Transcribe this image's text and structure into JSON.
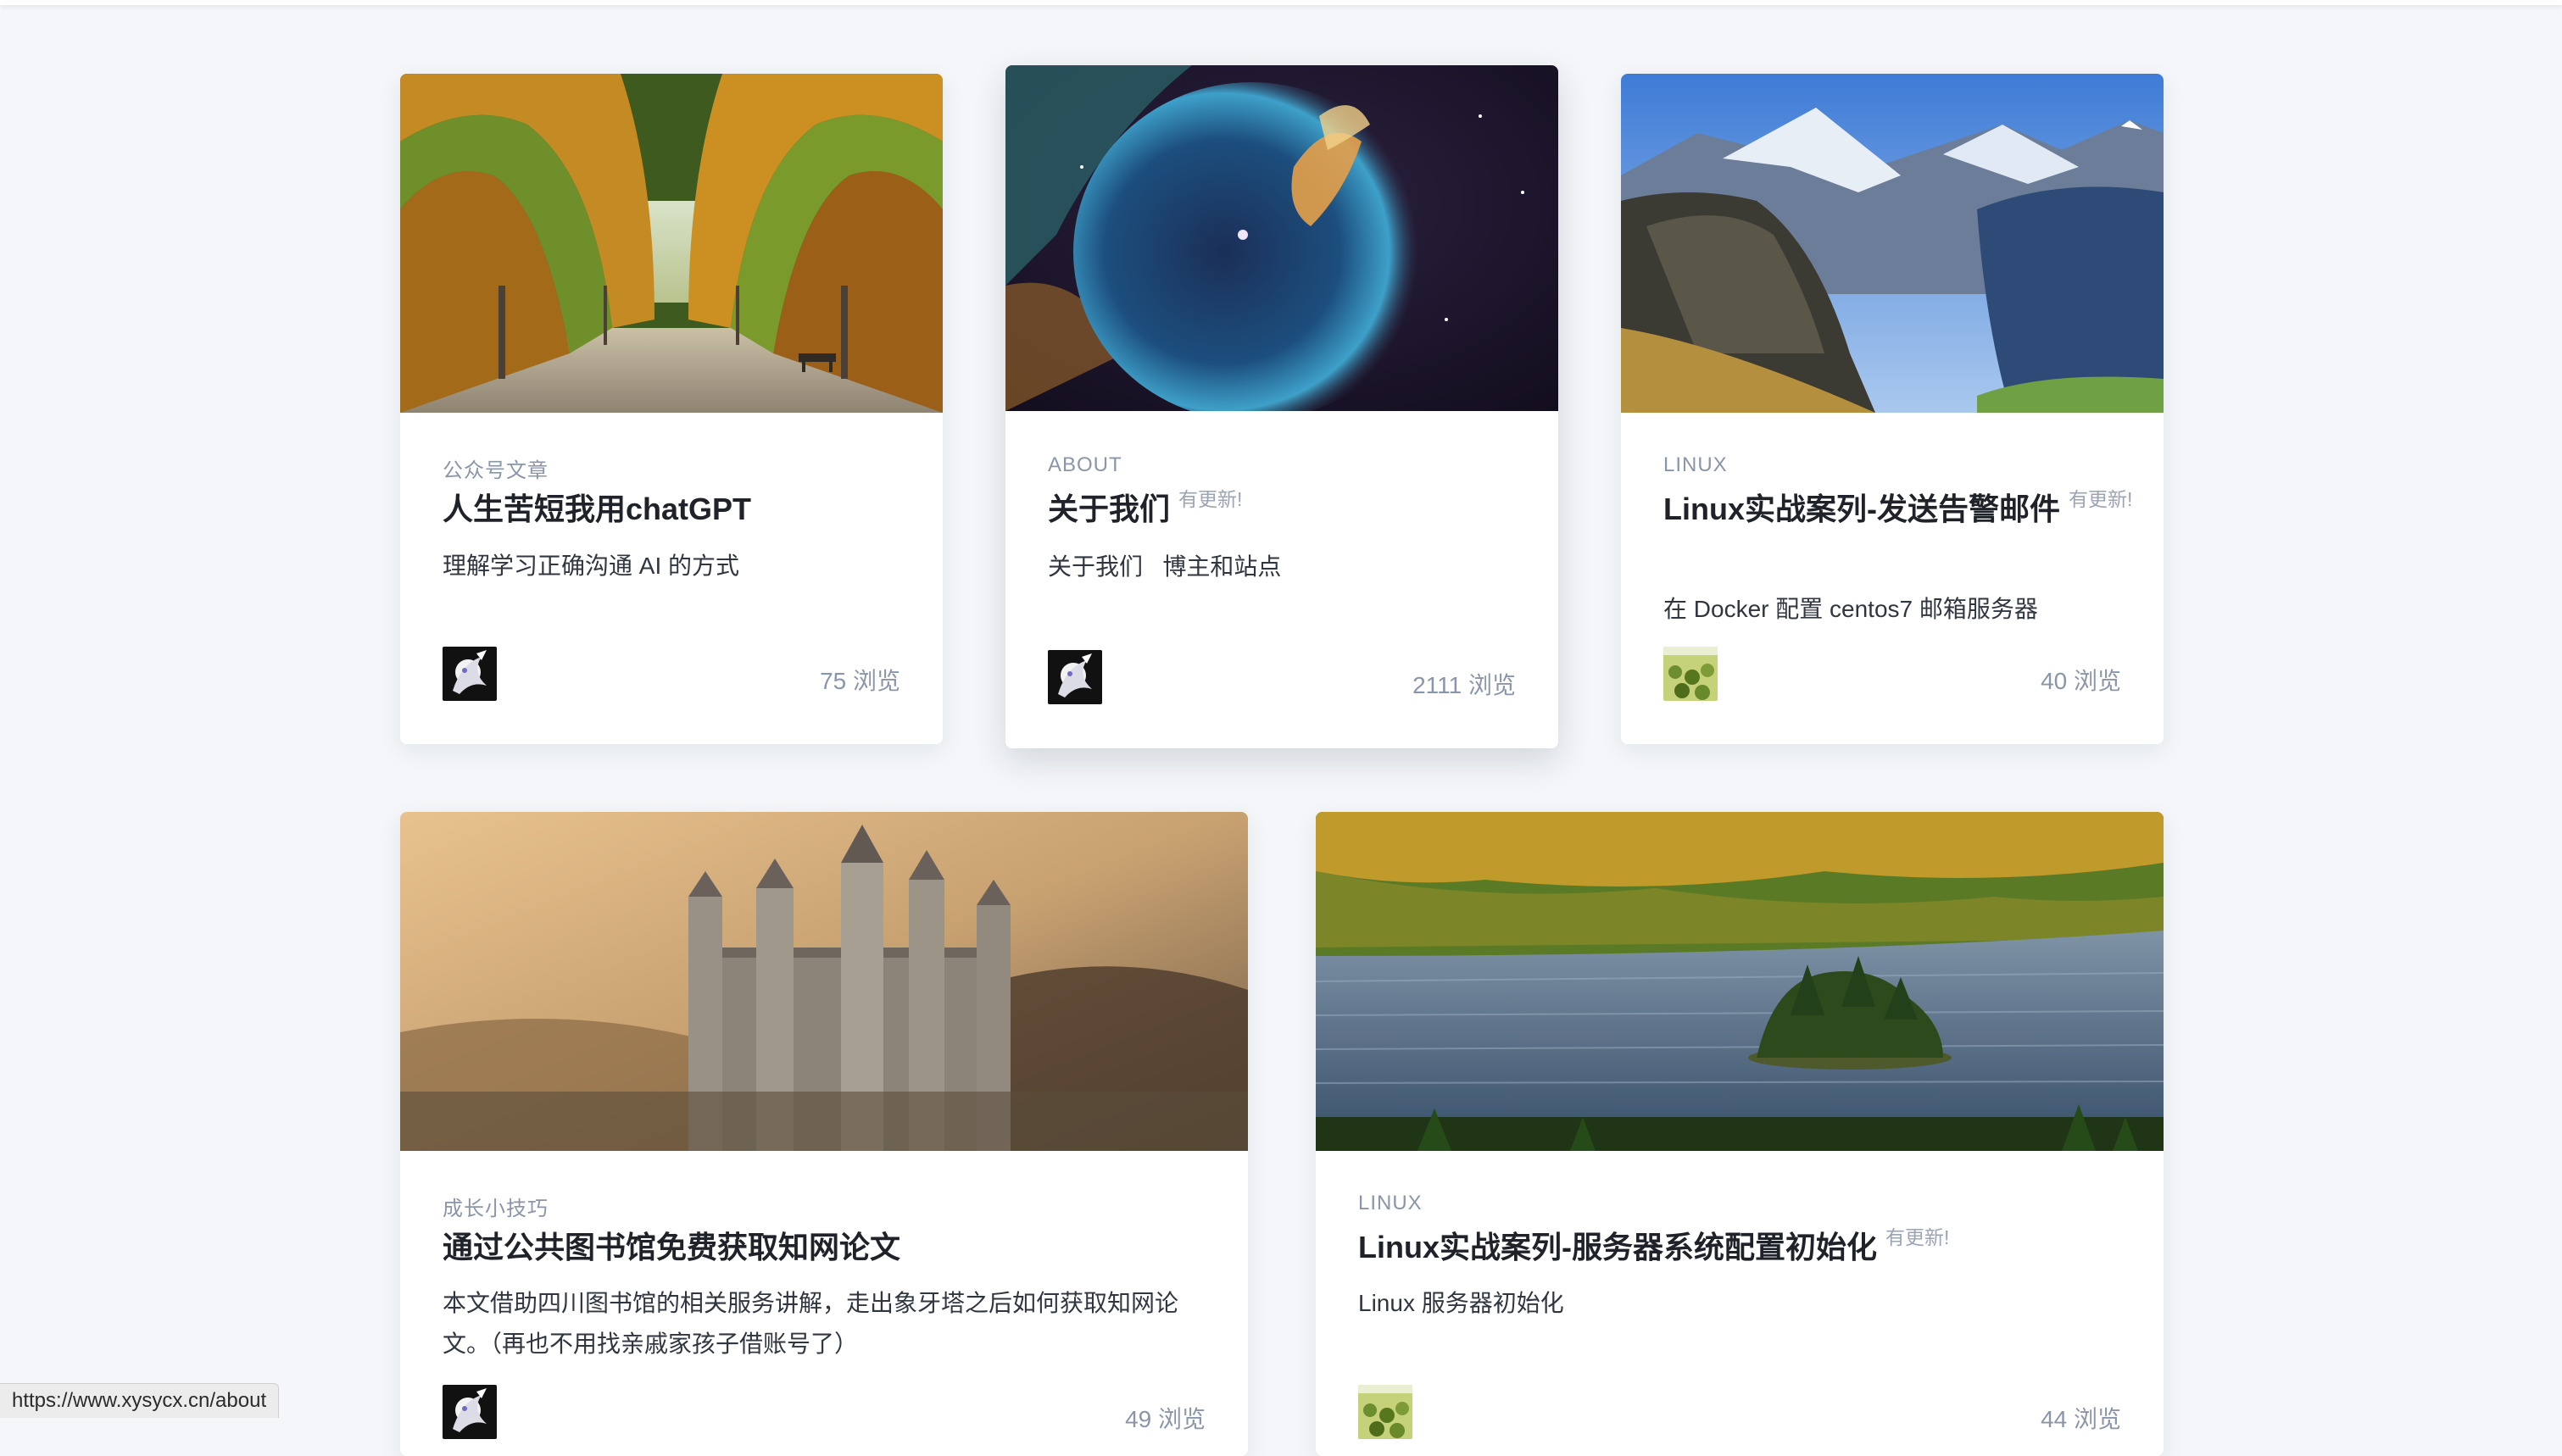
{
  "cards": [
    {
      "image": "autumn-tree-tunnel",
      "category": "公众号文章",
      "title": "人生苦短我用chatGPT",
      "updated": "",
      "excerpt": "理解学习正确沟通 AI 的方式",
      "avatar": "anime-avatar-icon",
      "views": "75 浏览"
    },
    {
      "image": "nebula-bubble",
      "category": "ABOUT",
      "title": "关于我们",
      "updated": "有更新!",
      "excerpt": "关于我们   博主和站点",
      "avatar": "anime-avatar-icon",
      "views": "2111 浏览"
    },
    {
      "image": "alpine-cliff",
      "category": "LINUX",
      "title": "Linux实战案列-发送告警邮件",
      "updated": "有更新!",
      "excerpt": "在 Docker 配置 centos7 邮箱服务器",
      "avatar": "field-avatar-icon",
      "views": "40 浏览"
    },
    {
      "image": "misty-castle",
      "category": "成长小技巧",
      "title": "通过公共图书馆免费获取知网论文",
      "updated": "",
      "excerpt": "本文借助四川图书馆的相关服务讲解，走出象牙塔之后如何获取知网论文。（再也不用找亲戚家孩子借账号了）",
      "avatar": "anime-avatar-icon",
      "views": "49 浏览"
    },
    {
      "image": "lake-island",
      "category": "LINUX",
      "title": "Linux实战案列-服务器系统配置初始化",
      "updated": "有更新!",
      "excerpt": "Linux 服务器初始化",
      "avatar": "field-avatar-icon",
      "views": "44 浏览"
    }
  ],
  "status_bar": {
    "url": "https://www.xysycx.cn/about"
  }
}
